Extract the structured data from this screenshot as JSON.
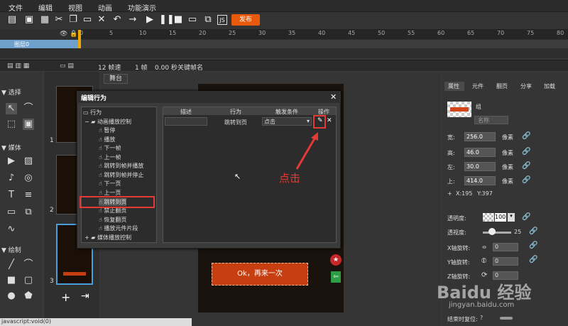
{
  "menu": [
    "文件",
    "编辑",
    "视图",
    "动画",
    "功能演示"
  ],
  "publish_label": "发布",
  "ruler_nums": [
    "0",
    "5",
    "10",
    "15",
    "20",
    "25",
    "30",
    "35",
    "40",
    "45",
    "50",
    "55",
    "60",
    "65",
    "70",
    "75",
    "80"
  ],
  "layer_name": "图层0",
  "timeline": {
    "fps": "12 帧速",
    "frame": "1 帧",
    "time": "0.00 秒",
    "keyframe": "关键帧名"
  },
  "tools": {
    "select": "选择",
    "media": "媒体",
    "draw": "绘制"
  },
  "pages": [
    "1",
    "2",
    "3"
  ],
  "stage_tab": "舞台",
  "retry_label": "Ok，再来一次",
  "dialog": {
    "title": "编辑行为",
    "tree": [
      "行为",
      "动画播放控制",
      "暂停",
      "播放",
      "下一帧",
      "上一帧",
      "跳转到帧并播放",
      "跳转到帧并停止",
      "下一页",
      "上一页",
      "跳转到页",
      "禁止翻页",
      "恢复翻页",
      "播放元件片段",
      "媒体播放控制"
    ],
    "headers": [
      "描述",
      "行为",
      "触发条件",
      "操作"
    ],
    "row": {
      "desc": "",
      "action": "跳转到页",
      "trigger": "点击"
    }
  },
  "annotation": "点击",
  "props": {
    "tabs": [
      "属性",
      "元件",
      "翻页",
      "分享",
      "加载"
    ],
    "group": "组",
    "name_placeholder": "名称",
    "width_label": "宽:",
    "width": "256.0",
    "height_label": "高:",
    "height": "46.0",
    "left_label": "左:",
    "left": "30.0",
    "top_label": "上:",
    "top": "414.0",
    "unit": "像素",
    "coord_x": "X:195",
    "coord_y": "Y:397",
    "opacity_label": "透明度:",
    "opacity": "100",
    "blur_label": "透视度:",
    "blur": "25",
    "xrot_label": "X轴旋转:",
    "xrot": "0",
    "yrot_label": "Y轴旋转:",
    "yrot": "0",
    "zrot_label": "Z轴旋转:",
    "zrot": "0",
    "keep_label": "结束时复位:"
  },
  "status": "javascript:void(0)",
  "watermark": "Baidu 经验",
  "watermark_url": "jingyan.baidu.com"
}
